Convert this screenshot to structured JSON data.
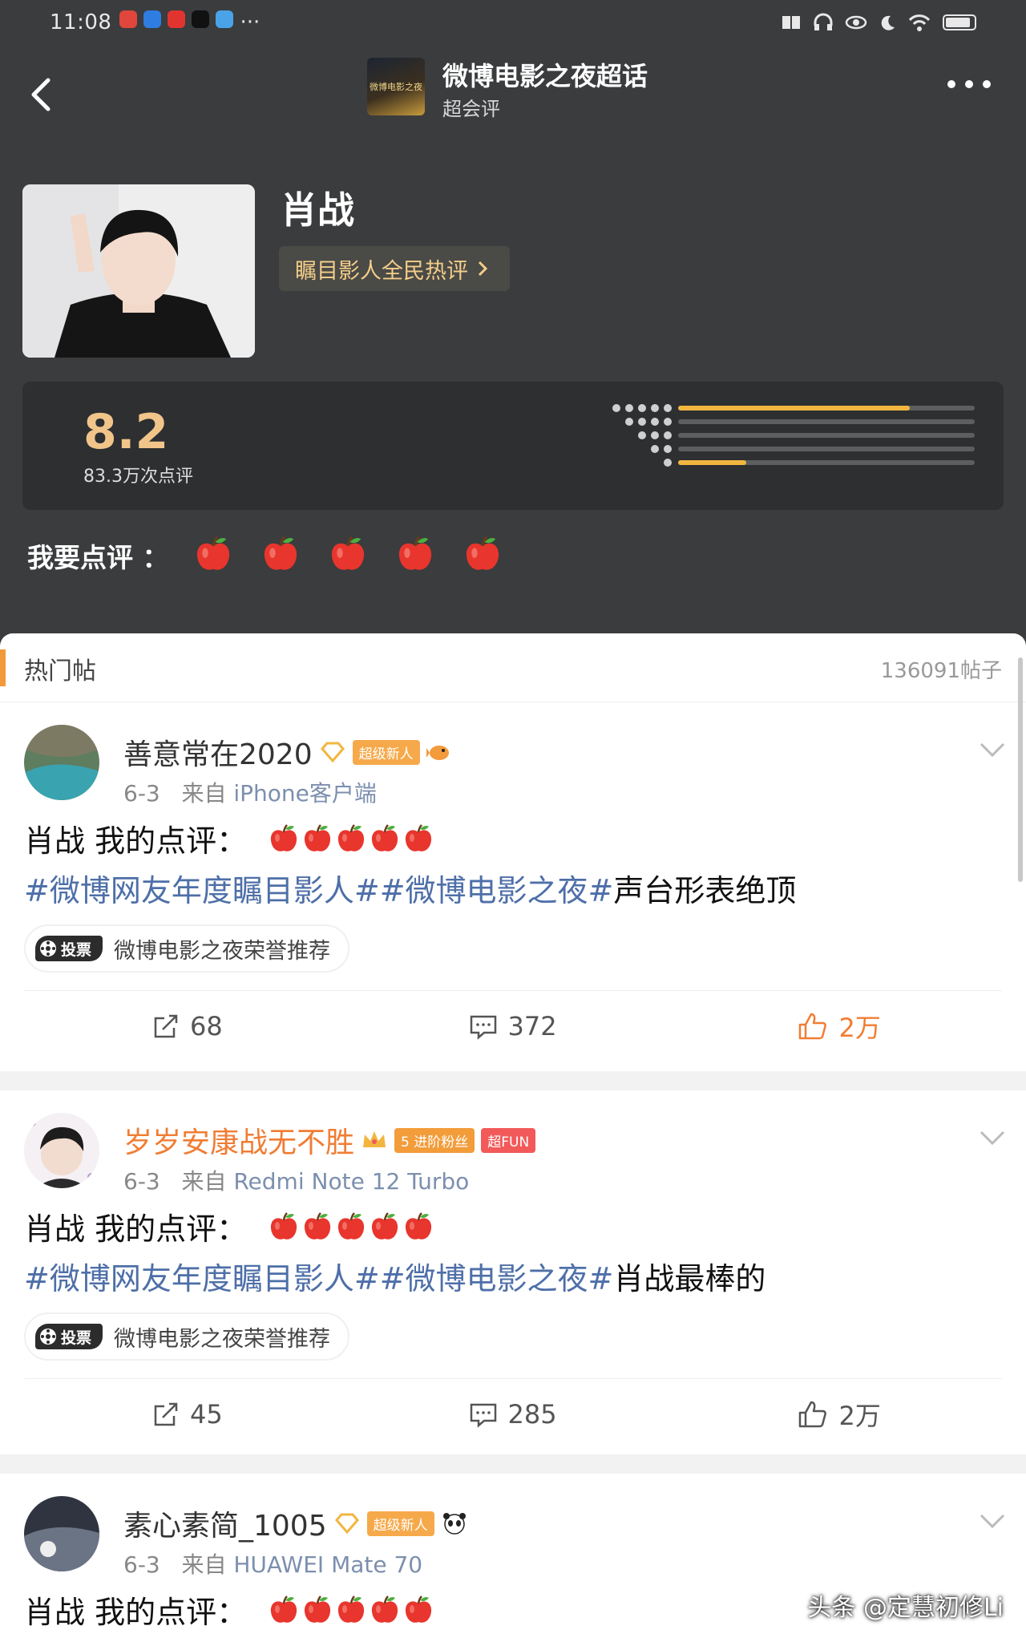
{
  "status_bar": {
    "time": "11:08",
    "dots": "···"
  },
  "topic": {
    "title": "微博电影之夜超话",
    "subtitle": "超会评",
    "thumb_text": "微博电影之夜"
  },
  "person": {
    "name": "肖战",
    "award_label": "瞩目影人全民热评"
  },
  "rating": {
    "score": "8.2",
    "count_label": "83.3万次点评",
    "distribution": [
      0.78,
      0,
      0,
      0,
      0.23
    ],
    "rate_label": "我要点评 ："
  },
  "feed": {
    "title": "热门帖",
    "total": "136091帖子"
  },
  "posts": [
    {
      "username": "善意常在2020",
      "badge": "超级新人",
      "date": "6-3",
      "source_prefix": "来自",
      "source": "iPhone客户端",
      "line1": "肖战 我的点评：",
      "tag1": "#微博网友年度瞩目影人#",
      "tag2": "#微博电影之夜#",
      "tail": "声台形表绝顶",
      "vote_label": "投票",
      "vote_text": "微博电影之夜荣誉推荐",
      "reposts": "68",
      "comments": "372",
      "likes": "2万"
    },
    {
      "username": "岁岁安康战无不胜",
      "badge": "进阶粉丝",
      "badge_level": "5",
      "badge2": "超FUN",
      "date": "6-3",
      "source_prefix": "来自",
      "source": "Redmi Note 12 Turbo",
      "line1": "肖战 我的点评：",
      "tag1": "#微博网友年度瞩目影人#",
      "tag2": "#微博电影之夜#",
      "tail": "肖战最棒的",
      "vote_label": "投票",
      "vote_text": "微博电影之夜荣誉推荐",
      "reposts": "45",
      "comments": "285",
      "likes": "2万"
    },
    {
      "username": "素心素简_1005",
      "badge": "超级新人",
      "date": "6-3",
      "source_prefix": "来自",
      "source": "HUAWEI Mate 70",
      "line1": "肖战 我的点评："
    }
  ],
  "watermark": "头条 @定慧初修Li",
  "colors": {
    "accent_orange": "#f07d33",
    "tag_blue": "#4e6fa8",
    "score_gold": "#f1c58a",
    "header_bg": "#3a3c3e"
  }
}
